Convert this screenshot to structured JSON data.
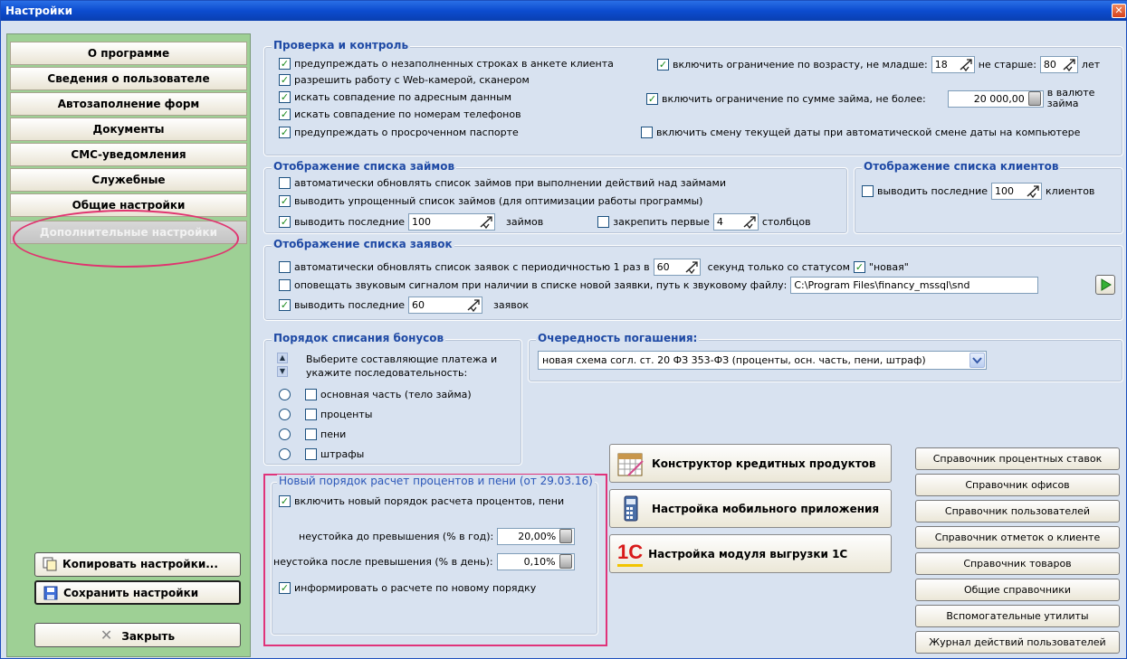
{
  "window": {
    "title": "Настройки",
    "close": "✕"
  },
  "sidebar": {
    "items": [
      {
        "label": "О программе"
      },
      {
        "label": "Сведения о пользователе"
      },
      {
        "label": "Автозаполнение форм"
      },
      {
        "label": "Документы"
      },
      {
        "label": "СМС-уведомления"
      },
      {
        "label": "Служебные"
      },
      {
        "label": "Общие настройки"
      },
      {
        "label": "Дополнительные настройки",
        "active": true
      }
    ],
    "copy_label": "Копировать настройки...",
    "save_label": "Сохранить настройки",
    "close_label": "Закрыть"
  },
  "checks": {
    "title": "Проверка и контроль",
    "items": [
      {
        "label": "предупреждать о незаполненных строках в анкете клиента",
        "checked": true
      },
      {
        "label": "разрешить работу с Web-камерой, сканером",
        "checked": true
      },
      {
        "label": "искать совпадение по адресным данным",
        "checked": true
      },
      {
        "label": "искать совпадение по номерам телефонов",
        "checked": true
      },
      {
        "label": "предупреждать о просроченном паспорте",
        "checked": true
      }
    ],
    "age_label": "включить ограничение по возрасту, не младше:",
    "age_min": "18",
    "age_max_label": "не старше:",
    "age_max": "80",
    "age_unit": "лет",
    "sum_label": "включить ограничение по сумме займа, не более:",
    "sum_value": "20 000,00",
    "sum_unit_1": "в валюте",
    "sum_unit_2": "займа",
    "date_label": "включить смену текущей даты при автоматической смене даты на компьютере"
  },
  "loans": {
    "title": "Отображение списка займов",
    "auto_refresh": "автоматически обновлять список займов при выполнении действий над займами",
    "simple_list": "выводить упрощенный список займов (для оптимизации работы программы)",
    "show_last": "выводить последние",
    "show_last_value": "100",
    "show_last_unit": "займов",
    "pin_label": "закрепить первые",
    "pin_value": "4",
    "pin_unit": "столбцов"
  },
  "clients": {
    "title": "Отображение списка клиентов",
    "show_last": "выводить последние",
    "value": "100",
    "unit": "клиентов"
  },
  "requests": {
    "title": "Отображение списка заявок",
    "auto_refresh": "автоматически обновлять список заявок с периодичностью 1 раз в",
    "interval": "60",
    "interval_unit": "секунд только со статусом",
    "status": "\"новая\"",
    "sound": "оповещать звуковым сигналом при наличии в списке новой заявки, путь к звуковому файлу:",
    "sound_path": "C:\\Program Files\\financy_mssql\\snd",
    "show_last": "выводить последние",
    "show_last_value": "60",
    "show_last_unit": "заявок"
  },
  "bonus": {
    "title": "Порядок списания бонусов",
    "hint_1": "Выберите составляющие платежа и",
    "hint_2": "укажите последовательность:",
    "items": [
      "основная часть (тело займа)",
      "проценты",
      "пени",
      "штрафы"
    ]
  },
  "queue": {
    "title": "Очередность погашения:",
    "selected": "новая схема согл. ст. 20 ФЗ 353-ФЗ (проценты, осн. часть, пени, штраф)"
  },
  "interest": {
    "title": "Новый порядок расчет процентов и пени (от 29.03.16)",
    "enable": "включить новый порядок расчета процентов, пени",
    "penalty_before_label": "неустойка до превышения (% в год):",
    "penalty_before": "20,00%",
    "penalty_after_label": "неустойка после превышения (% в день):",
    "penalty_after": "0,10%",
    "inform": "информировать о расчете по новому порядку"
  },
  "actions": {
    "constructor": "Конструктор кредитных продуктов",
    "mobile": "Настройка мобильного приложения",
    "onec_logo": "1С",
    "onec": "Настройка модуля выгрузки 1С"
  },
  "references": [
    "Справочник процентных ставок",
    "Справочник офисов",
    "Справочник пользователей",
    "Справочник отметок о клиенте",
    "Справочник товаров",
    "Общие справочники",
    "Вспомогательные утилиты",
    "Журнал действий пользователей"
  ]
}
